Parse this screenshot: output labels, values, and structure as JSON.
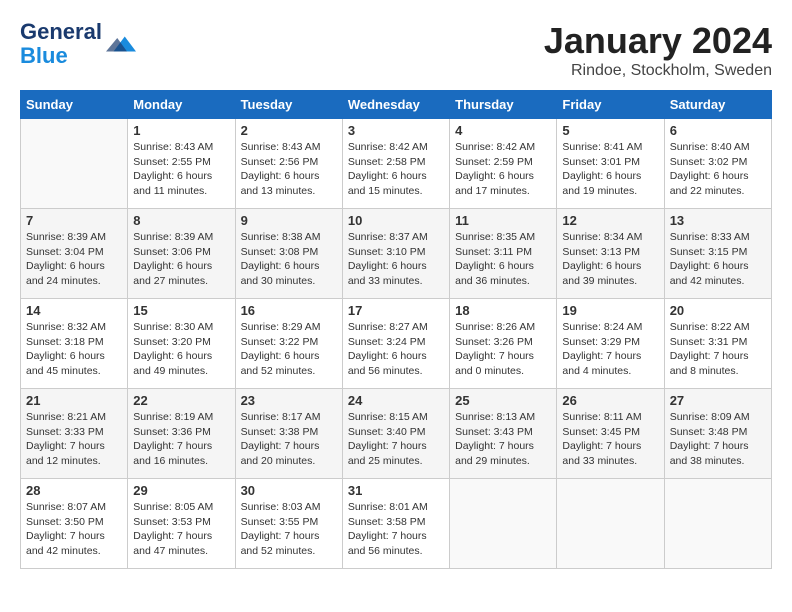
{
  "header": {
    "logo_line1": "General",
    "logo_line2": "Blue",
    "month": "January 2024",
    "location": "Rindoe, Stockholm, Sweden"
  },
  "weekdays": [
    "Sunday",
    "Monday",
    "Tuesday",
    "Wednesday",
    "Thursday",
    "Friday",
    "Saturday"
  ],
  "weeks": [
    [
      {
        "day": "",
        "info": ""
      },
      {
        "day": "1",
        "info": "Sunrise: 8:43 AM\nSunset: 2:55 PM\nDaylight: 6 hours\nand 11 minutes."
      },
      {
        "day": "2",
        "info": "Sunrise: 8:43 AM\nSunset: 2:56 PM\nDaylight: 6 hours\nand 13 minutes."
      },
      {
        "day": "3",
        "info": "Sunrise: 8:42 AM\nSunset: 2:58 PM\nDaylight: 6 hours\nand 15 minutes."
      },
      {
        "day": "4",
        "info": "Sunrise: 8:42 AM\nSunset: 2:59 PM\nDaylight: 6 hours\nand 17 minutes."
      },
      {
        "day": "5",
        "info": "Sunrise: 8:41 AM\nSunset: 3:01 PM\nDaylight: 6 hours\nand 19 minutes."
      },
      {
        "day": "6",
        "info": "Sunrise: 8:40 AM\nSunset: 3:02 PM\nDaylight: 6 hours\nand 22 minutes."
      }
    ],
    [
      {
        "day": "7",
        "info": "Sunrise: 8:39 AM\nSunset: 3:04 PM\nDaylight: 6 hours\nand 24 minutes."
      },
      {
        "day": "8",
        "info": "Sunrise: 8:39 AM\nSunset: 3:06 PM\nDaylight: 6 hours\nand 27 minutes."
      },
      {
        "day": "9",
        "info": "Sunrise: 8:38 AM\nSunset: 3:08 PM\nDaylight: 6 hours\nand 30 minutes."
      },
      {
        "day": "10",
        "info": "Sunrise: 8:37 AM\nSunset: 3:10 PM\nDaylight: 6 hours\nand 33 minutes."
      },
      {
        "day": "11",
        "info": "Sunrise: 8:35 AM\nSunset: 3:11 PM\nDaylight: 6 hours\nand 36 minutes."
      },
      {
        "day": "12",
        "info": "Sunrise: 8:34 AM\nSunset: 3:13 PM\nDaylight: 6 hours\nand 39 minutes."
      },
      {
        "day": "13",
        "info": "Sunrise: 8:33 AM\nSunset: 3:15 PM\nDaylight: 6 hours\nand 42 minutes."
      }
    ],
    [
      {
        "day": "14",
        "info": "Sunrise: 8:32 AM\nSunset: 3:18 PM\nDaylight: 6 hours\nand 45 minutes."
      },
      {
        "day": "15",
        "info": "Sunrise: 8:30 AM\nSunset: 3:20 PM\nDaylight: 6 hours\nand 49 minutes."
      },
      {
        "day": "16",
        "info": "Sunrise: 8:29 AM\nSunset: 3:22 PM\nDaylight: 6 hours\nand 52 minutes."
      },
      {
        "day": "17",
        "info": "Sunrise: 8:27 AM\nSunset: 3:24 PM\nDaylight: 6 hours\nand 56 minutes."
      },
      {
        "day": "18",
        "info": "Sunrise: 8:26 AM\nSunset: 3:26 PM\nDaylight: 7 hours\nand 0 minutes."
      },
      {
        "day": "19",
        "info": "Sunrise: 8:24 AM\nSunset: 3:29 PM\nDaylight: 7 hours\nand 4 minutes."
      },
      {
        "day": "20",
        "info": "Sunrise: 8:22 AM\nSunset: 3:31 PM\nDaylight: 7 hours\nand 8 minutes."
      }
    ],
    [
      {
        "day": "21",
        "info": "Sunrise: 8:21 AM\nSunset: 3:33 PM\nDaylight: 7 hours\nand 12 minutes."
      },
      {
        "day": "22",
        "info": "Sunrise: 8:19 AM\nSunset: 3:36 PM\nDaylight: 7 hours\nand 16 minutes."
      },
      {
        "day": "23",
        "info": "Sunrise: 8:17 AM\nSunset: 3:38 PM\nDaylight: 7 hours\nand 20 minutes."
      },
      {
        "day": "24",
        "info": "Sunrise: 8:15 AM\nSunset: 3:40 PM\nDaylight: 7 hours\nand 25 minutes."
      },
      {
        "day": "25",
        "info": "Sunrise: 8:13 AM\nSunset: 3:43 PM\nDaylight: 7 hours\nand 29 minutes."
      },
      {
        "day": "26",
        "info": "Sunrise: 8:11 AM\nSunset: 3:45 PM\nDaylight: 7 hours\nand 33 minutes."
      },
      {
        "day": "27",
        "info": "Sunrise: 8:09 AM\nSunset: 3:48 PM\nDaylight: 7 hours\nand 38 minutes."
      }
    ],
    [
      {
        "day": "28",
        "info": "Sunrise: 8:07 AM\nSunset: 3:50 PM\nDaylight: 7 hours\nand 42 minutes."
      },
      {
        "day": "29",
        "info": "Sunrise: 8:05 AM\nSunset: 3:53 PM\nDaylight: 7 hours\nand 47 minutes."
      },
      {
        "day": "30",
        "info": "Sunrise: 8:03 AM\nSunset: 3:55 PM\nDaylight: 7 hours\nand 52 minutes."
      },
      {
        "day": "31",
        "info": "Sunrise: 8:01 AM\nSunset: 3:58 PM\nDaylight: 7 hours\nand 56 minutes."
      },
      {
        "day": "",
        "info": ""
      },
      {
        "day": "",
        "info": ""
      },
      {
        "day": "",
        "info": ""
      }
    ]
  ]
}
